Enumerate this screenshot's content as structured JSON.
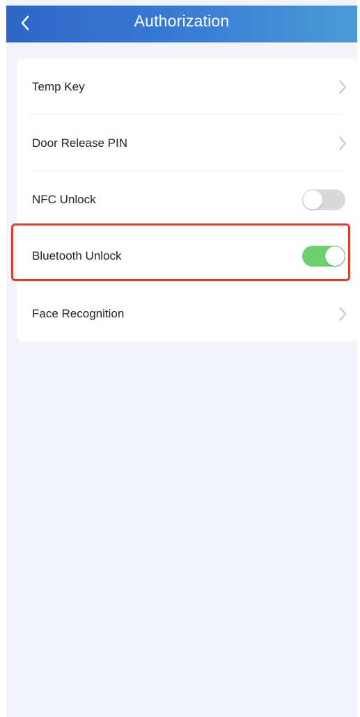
{
  "header": {
    "title": "Authorization",
    "background_gradient": [
      "#2f64c7",
      "#3a7ed3",
      "#4d9ad8"
    ]
  },
  "settings": {
    "items": [
      {
        "label": "Temp Key",
        "control": "chevron-right-icon"
      },
      {
        "label": "Door Release PIN",
        "control": "chevron-right-icon"
      },
      {
        "label": "NFC Unlock",
        "control": "toggle",
        "checked": false
      },
      {
        "label": "Bluetooth Unlock",
        "control": "toggle",
        "checked": true
      },
      {
        "label": "Face Recognition",
        "control": "chevron-right-icon"
      }
    ]
  },
  "highlight": {
    "target": "Bluetooth Unlock",
    "color": "#d8402f"
  },
  "colors": {
    "page_background": "#f3f5fa",
    "card_background": "#ffffff",
    "toggle_on": "#6bd06d",
    "toggle_off": "#d9d9d9",
    "text": "#222222"
  }
}
